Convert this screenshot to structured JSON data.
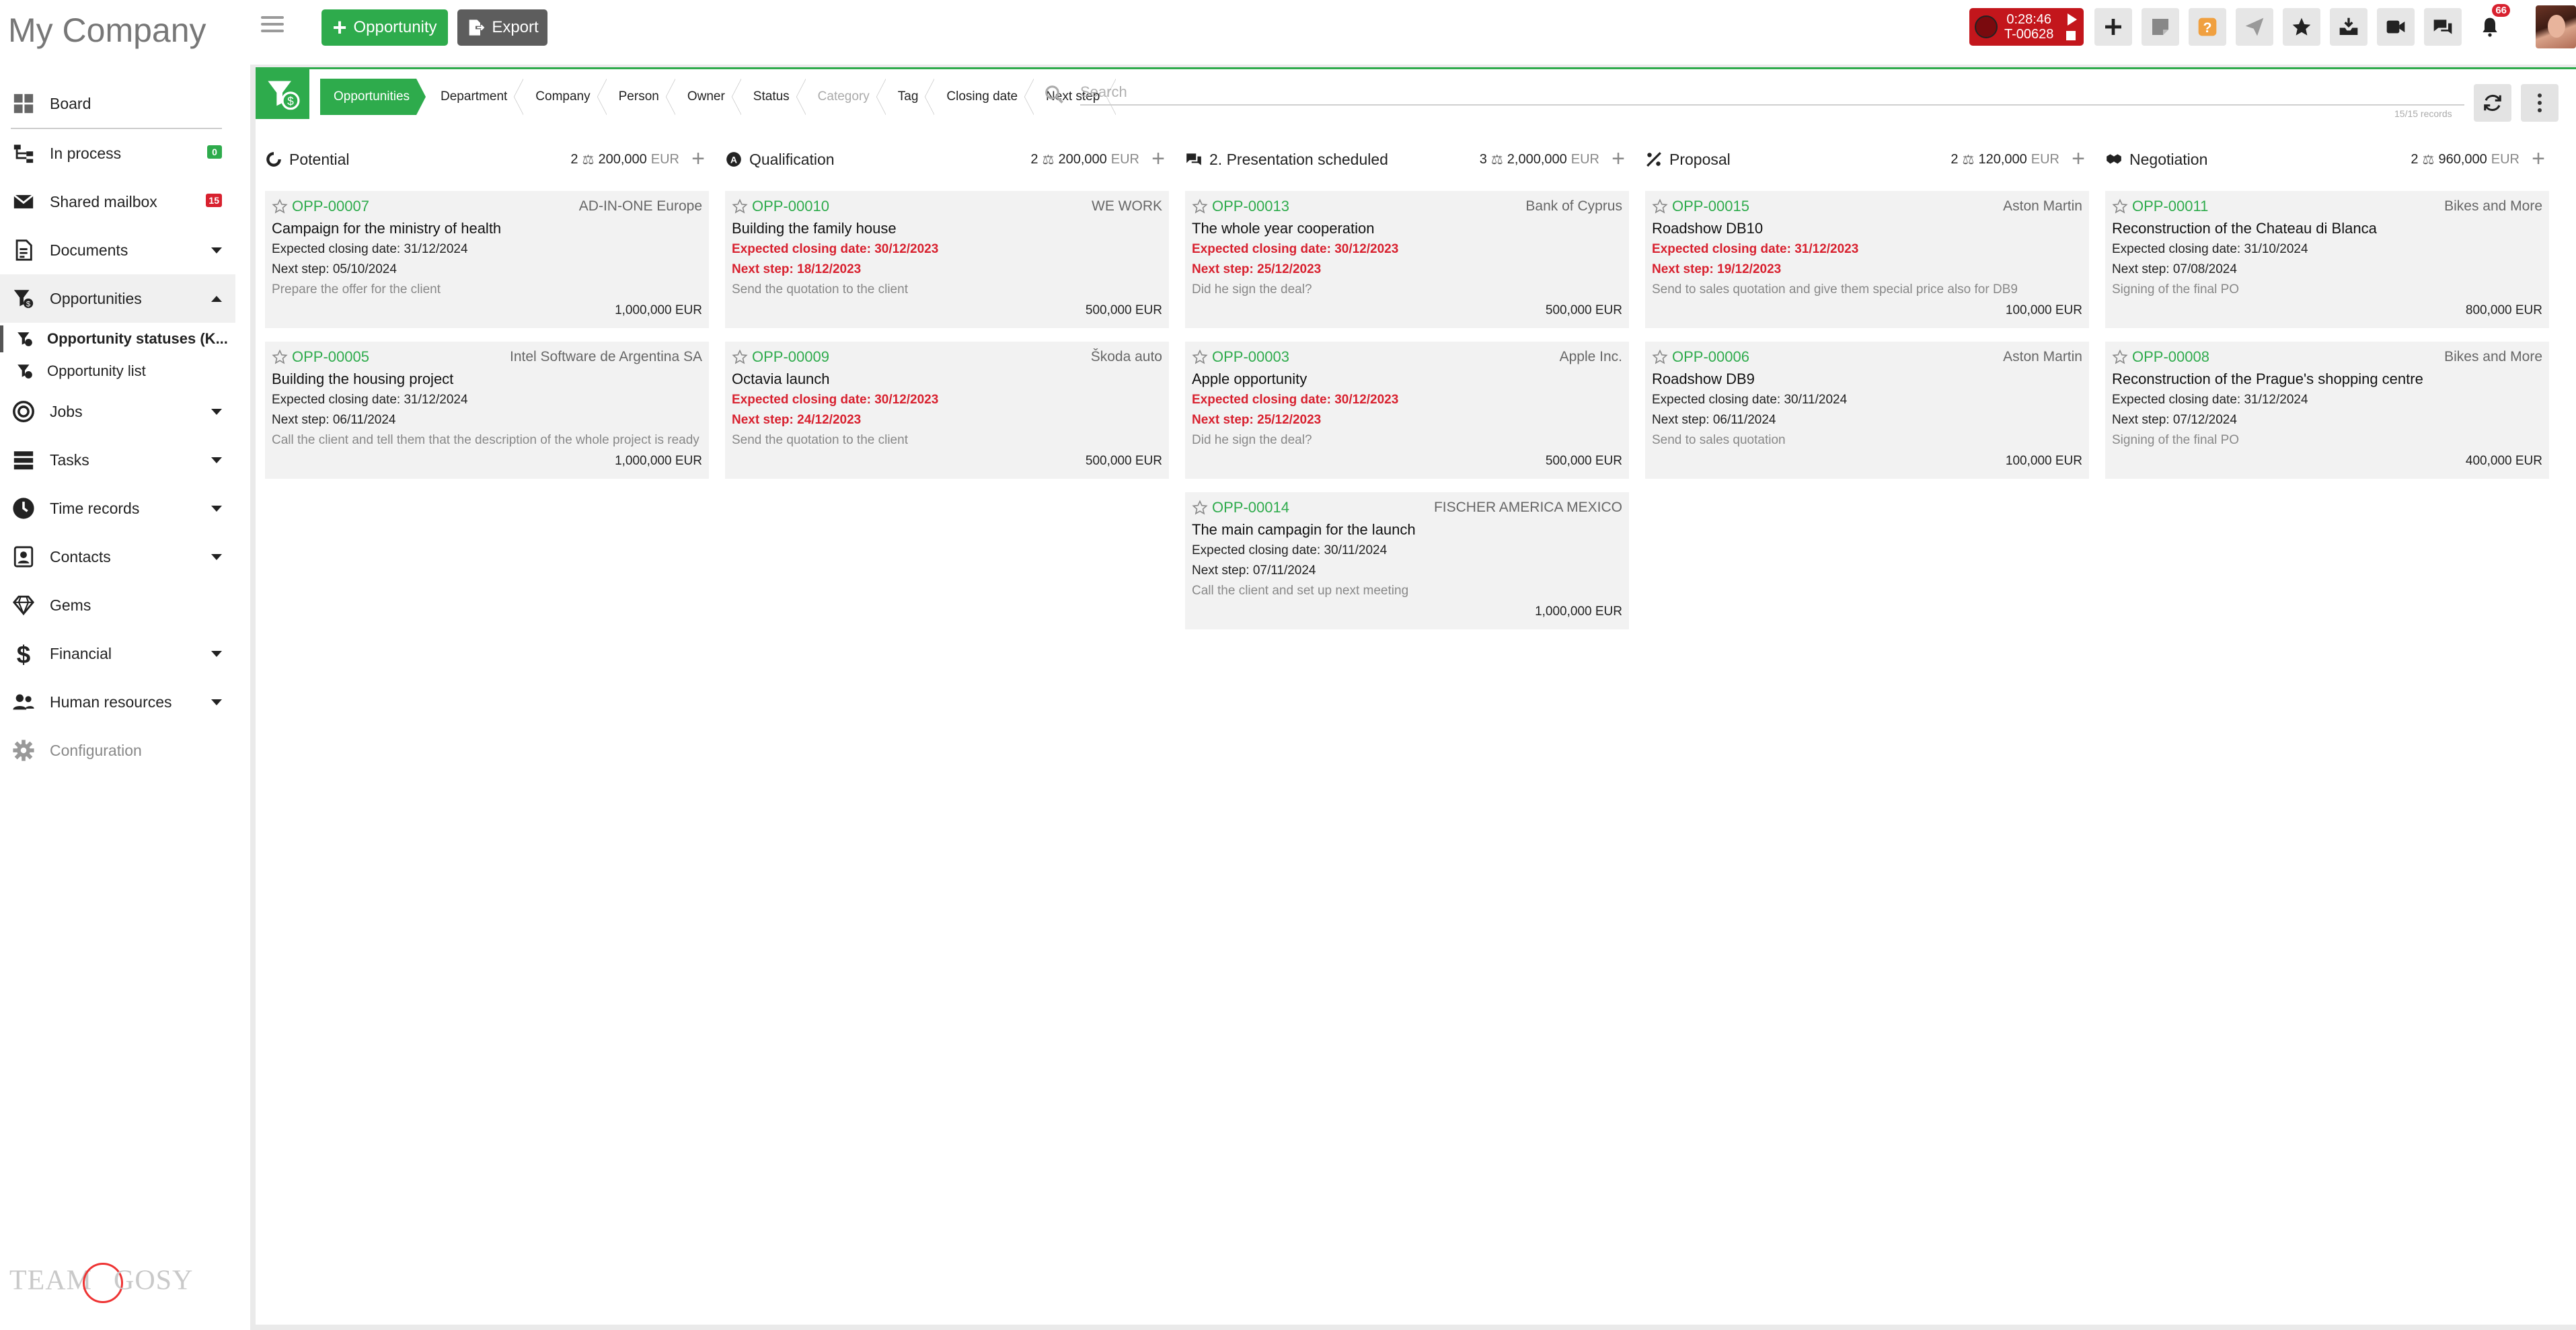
{
  "company_name": "My Company",
  "nav": {
    "board": "Board",
    "in_process": "In process",
    "in_process_count": "0",
    "shared_mailbox": "Shared mailbox",
    "shared_mailbox_count": "15",
    "documents": "Documents",
    "opportunities": "Opportunities",
    "sub_statuses": "Opportunity statuses (K...",
    "sub_list": "Opportunity list",
    "jobs": "Jobs",
    "tasks": "Tasks",
    "time_records": "Time records",
    "contacts": "Contacts",
    "gems": "Gems",
    "financial": "Financial",
    "human_resources": "Human resources",
    "configuration": "Configuration"
  },
  "logo_text": "TEAMGOSY",
  "toolbar": {
    "add_opportunity": "Opportunity",
    "export": "Export",
    "timer_time": "0:28:46",
    "timer_task": "T-00628",
    "notifications_count": "66"
  },
  "filters": {
    "crumbs": [
      "Opportunities",
      "Department",
      "Company",
      "Person",
      "Owner",
      "Status",
      "Category",
      "Tag",
      "Closing date",
      "Next step"
    ],
    "search_placeholder": "Search",
    "records": "15/15 records"
  },
  "columns": [
    {
      "name": "Potential",
      "count": "2",
      "total": "200,000",
      "currency": "EUR",
      "cards": [
        {
          "code": "OPP-00007",
          "company": "AD-IN-ONE Europe",
          "title": "Campaign for the ministry of health",
          "closing": "Expected closing date: 31/12/2024",
          "next": "Next step: 05/10/2024",
          "note": "Prepare the offer for the client",
          "amount": "1,000,000 EUR",
          "overdue": false
        },
        {
          "code": "OPP-00005",
          "company": "Intel Software de Argentina SA",
          "title": "Building the housing project",
          "closing": "Expected closing date: 31/12/2024",
          "next": "Next step: 06/11/2024",
          "note": "Call the client and tell them that the description of the whole project is ready",
          "amount": "1,000,000 EUR",
          "overdue": false
        }
      ]
    },
    {
      "name": "Qualification",
      "count": "2",
      "total": "200,000",
      "currency": "EUR",
      "cards": [
        {
          "code": "OPP-00010",
          "company": "WE WORK",
          "title": "Building the family house",
          "closing": "Expected closing date: 30/12/2023",
          "next": "Next step: 18/12/2023",
          "note": "Send the quotation to the client",
          "amount": "500,000 EUR",
          "overdue": true
        },
        {
          "code": "OPP-00009",
          "company": "Škoda auto",
          "title": "Octavia launch",
          "closing": "Expected closing date: 30/12/2023",
          "next": "Next step: 24/12/2023",
          "note": "Send the quotation to the client",
          "amount": "500,000 EUR",
          "overdue": true
        }
      ]
    },
    {
      "name": "2. Presentation scheduled",
      "count": "3",
      "total": "2,000,000",
      "currency": "EUR",
      "cards": [
        {
          "code": "OPP-00013",
          "company": "Bank of Cyprus",
          "title": "The whole year cooperation",
          "closing": "Expected closing date: 30/12/2023",
          "next": "Next step: 25/12/2023",
          "note": "Did he sign the deal?",
          "amount": "500,000 EUR",
          "overdue": true
        },
        {
          "code": "OPP-00003",
          "company": "Apple Inc.",
          "title": "Apple opportunity",
          "closing": "Expected closing date: 30/12/2023",
          "next": "Next step: 25/12/2023",
          "note": "Did he sign the deal?",
          "amount": "500,000 EUR",
          "overdue": true
        },
        {
          "code": "OPP-00014",
          "company": "FISCHER AMERICA MEXICO",
          "title": "The main campagin for the launch",
          "closing": "Expected closing date: 30/11/2024",
          "next": "Next step: 07/11/2024",
          "note": "Call the client and set up next meeting",
          "amount": "1,000,000 EUR",
          "overdue": false
        }
      ]
    },
    {
      "name": "Proposal",
      "count": "2",
      "total": "120,000",
      "currency": "EUR",
      "cards": [
        {
          "code": "OPP-00015",
          "company": "Aston Martin",
          "title": "Roadshow DB10",
          "closing": "Expected closing date: 31/12/2023",
          "next": "Next step: 19/12/2023",
          "note": "Send to sales quotation and give them special price also for DB9",
          "amount": "100,000 EUR",
          "overdue": true
        },
        {
          "code": "OPP-00006",
          "company": "Aston Martin",
          "title": "Roadshow DB9",
          "closing": "Expected closing date: 30/11/2024",
          "next": "Next step: 06/11/2024",
          "note": "Send to sales quotation",
          "amount": "100,000 EUR",
          "overdue": false
        }
      ]
    },
    {
      "name": "Negotiation",
      "count": "2",
      "total": "960,000",
      "currency": "EUR",
      "cards": [
        {
          "code": "OPP-00011",
          "company": "Bikes and More",
          "title": "Reconstruction of the Chateau di Blanca",
          "closing": "Expected closing date: 31/10/2024",
          "next": "Next step: 07/08/2024",
          "note": "Signing of the final PO",
          "amount": "800,000 EUR",
          "overdue": false
        },
        {
          "code": "OPP-00008",
          "company": "Bikes and More",
          "title": "Reconstruction of the Prague's shopping centre",
          "closing": "Expected closing date: 31/12/2024",
          "next": "Next step: 07/12/2024",
          "note": "Signing of the final PO",
          "amount": "400,000 EUR",
          "overdue": false
        }
      ]
    }
  ],
  "colors": {
    "accent": "#2eab4c",
    "danger": "#d8212f",
    "card_bg": "#f2f2f2"
  }
}
